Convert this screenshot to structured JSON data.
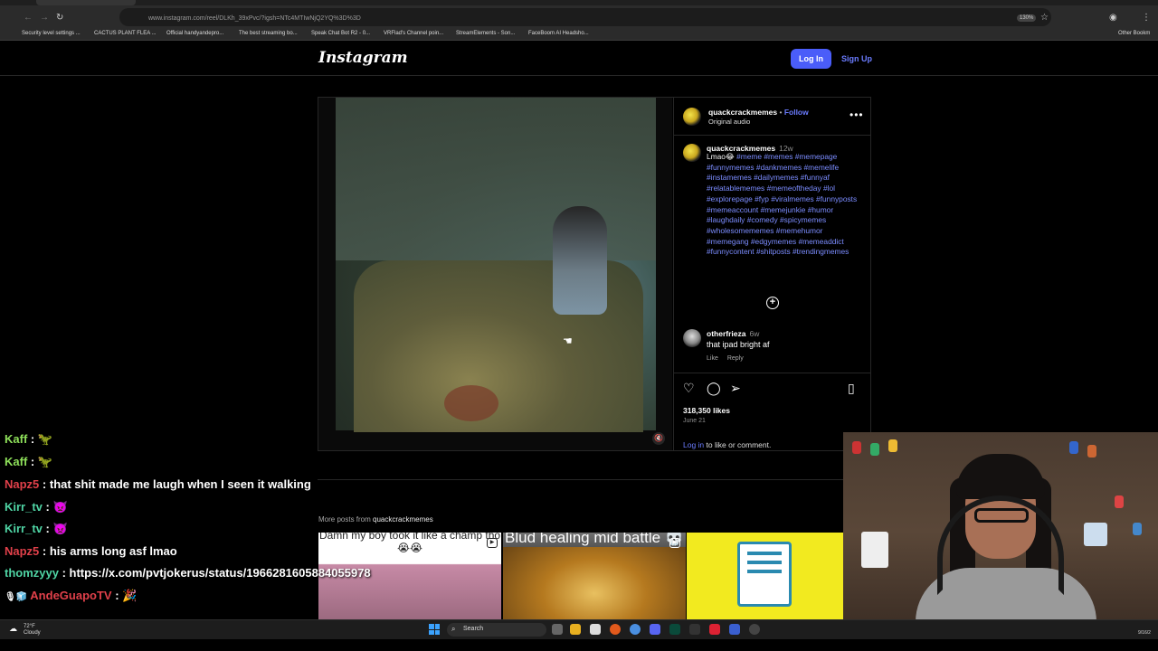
{
  "browser": {
    "url": "www.instagram.com/reel/DLKh_39xPvc/?igsh=NTc4MTIwNjQ2YQ%3D%3D",
    "zoom": "130%",
    "bookmarks": [
      "Security level settings ...",
      "CACTUS PLANT FLEA ...",
      "Official handyandepro...",
      "The best streaming bo...",
      "Speak Chat Bot R2 - 0...",
      "VRFlad's Channel poin...",
      "StreamElements - Son...",
      "FaceBoom AI Headsho...",
      "Other Bookm"
    ]
  },
  "header": {
    "logo": "Instagram",
    "login": "Log In",
    "signup": "Sign Up"
  },
  "post": {
    "author": "quackcrackmemes",
    "follow": "Follow",
    "separator": "•",
    "audio": "Original audio",
    "caption_author": "quackcrackmemes",
    "caption_age": "12w",
    "caption_text": "Lmao😂",
    "hashtags": "#meme #memes #memepage #funnymemes #dankmemes #memelife #instamemes #dailymemes #funnyaf #relatablememes #memeoftheday #lol #explorepage #fyp #viralmemes #funnyposts #memeaccount #memejunkie #humor #laughdaily #comedy #spicymemes #wholesomememes #memehumor #memegang #edgymemes #memeaddict #funnycontent #shitposts #trendingmemes",
    "comment_author": "otherfrieza",
    "comment_age": "6w",
    "comment_text": "that ipad bright af",
    "comment_like": "Like",
    "comment_reply": "Reply",
    "likes": "318,350 likes",
    "date": "June 21",
    "login_link": "Log in",
    "login_suffix": "to like or comment."
  },
  "more_posts": {
    "label": "More posts from",
    "author": "quackcrackmemes",
    "thumbs": [
      {
        "caption": "Damn my boy took it like a champ tho 😭😭",
        "color": "#c78aa6"
      },
      {
        "caption": "Blud healing mid battle 💀",
        "color": "#b5791f"
      },
      {
        "caption": "",
        "color": "#f2ea1f"
      }
    ]
  },
  "chat": [
    {
      "user": "Kaff",
      "color": "#8ee05a",
      "message": "🦖"
    },
    {
      "user": "Kaff",
      "color": "#8ee05a",
      "message": "🦖"
    },
    {
      "user": "Napz5",
      "color": "#e0404a",
      "message": "that shit made me laugh when I seen it walking"
    },
    {
      "user": "Kirr_tv",
      "color": "#4fd4a4",
      "message": "👿"
    },
    {
      "user": "Kirr_tv",
      "color": "#4fd4a4",
      "message": "👿"
    },
    {
      "user": "Napz5",
      "color": "#e0404a",
      "message": "his arms long asf lmao"
    },
    {
      "user": "thomzyyy",
      "color": "#4fd4a4",
      "message": "https://x.com/pvtjokerus/status/1966281605884055978"
    },
    {
      "user": "AndeGuapoTV",
      "color": "#e0404a",
      "message": "🎉"
    }
  ],
  "taskbar": {
    "weather_temp": "72°F",
    "weather_desc": "Cloudy",
    "search": "Search",
    "date": "9/16/2"
  },
  "colors": {
    "accent": "#4a5df9",
    "link": "#6b7cff"
  }
}
